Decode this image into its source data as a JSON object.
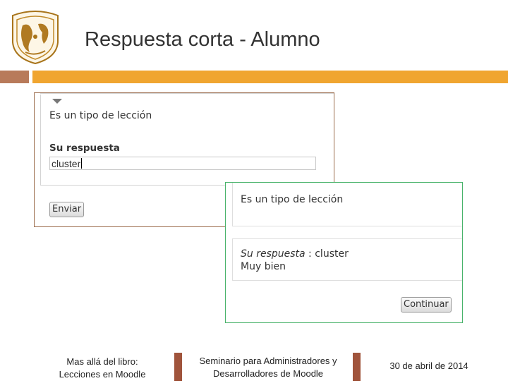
{
  "slide": {
    "title": "Respuesta corta - Alumno"
  },
  "question_form": {
    "question_text": "Es un tipo de lección",
    "answer_label": "Su respuesta",
    "answer_value": "cluster",
    "submit_label": "Enviar"
  },
  "feedback": {
    "question_text": "Es un tipo de lección",
    "answer_label": "Su respuesta",
    "answer_separator": " : ",
    "answer_value": "cluster",
    "feedback_text": "Muy bien",
    "continue_label": "Continuar"
  },
  "footer": {
    "left_line1": "Mas allá del libro:",
    "left_line2": "Lecciones en Moodle",
    "center_line1": "Seminario para Administradores y",
    "center_line2": "Desarrolladores de Moodle",
    "date": "30 de abril de 2014"
  },
  "colors": {
    "accent_bar": "#f0a530",
    "accent_small": "#b87a5a",
    "separator": "#a0543c",
    "feedback_border": "#49b36b",
    "form_border": "#9a6a4a"
  },
  "icons": {
    "logo": "unam-seal-logo",
    "collapse": "collapse-triangle-icon"
  }
}
